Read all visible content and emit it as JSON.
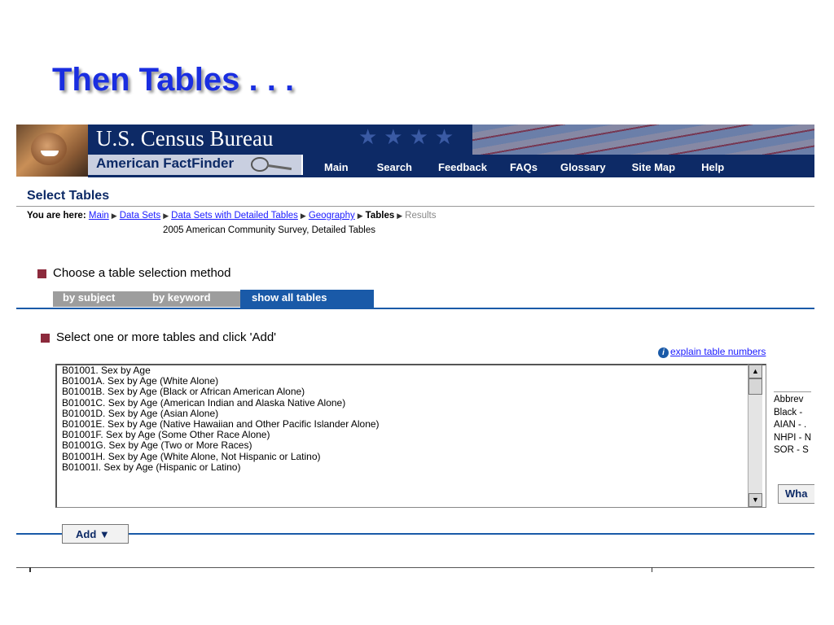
{
  "slide": {
    "title": "Then Tables . . ."
  },
  "header": {
    "site_title": "U.S. Census Bureau",
    "product": "American FactFinder",
    "nav": [
      "Main",
      "Search",
      "Feedback",
      "FAQs",
      "Glossary",
      "Site Map",
      "Help"
    ]
  },
  "page": {
    "heading": "Select Tables",
    "you_are_here_label": "You are here:",
    "breadcrumb": {
      "main": "Main",
      "data_sets": "Data Sets",
      "detailed": "Data Sets with Detailed Tables",
      "geography": "Geography",
      "tables": "Tables",
      "results": "Results"
    },
    "dataset": "2005 American Community Survey, Detailed Tables"
  },
  "method": {
    "prompt": "Choose a table selection method",
    "tabs": [
      "by subject",
      "by keyword",
      "show all tables"
    ],
    "active_tab": "show all tables"
  },
  "select": {
    "prompt": "Select one or more tables and click 'Add'",
    "explain_link": "explain table numbers",
    "items": [
      "B01001. Sex by Age",
      "B01001A. Sex by Age (White Alone)",
      "B01001B. Sex by Age (Black or African American Alone)",
      "B01001C. Sex by Age (American Indian and Alaska Native Alone)",
      "B01001D. Sex by Age (Asian Alone)",
      "B01001E. Sex by Age (Native Hawaiian and Other Pacific Islander Alone)",
      "B01001F. Sex by Age (Some Other Race Alone)",
      "B01001G. Sex by Age (Two or More Races)",
      "B01001H. Sex by Age (White Alone, Not Hispanic or Latino)",
      "B01001I. Sex by Age (Hispanic or Latino)"
    ],
    "abbrev": [
      "Abbrev",
      "Black -",
      "AIAN - .",
      "NHPI - N",
      "SOR - S"
    ],
    "what_button": "Wha",
    "add_button": "Add ▼"
  },
  "colors": {
    "navy": "#0d2a66",
    "accent_blue": "#1a5aa8",
    "bullet": "#8c2a3c",
    "title_blue": "#1a2ee0"
  }
}
